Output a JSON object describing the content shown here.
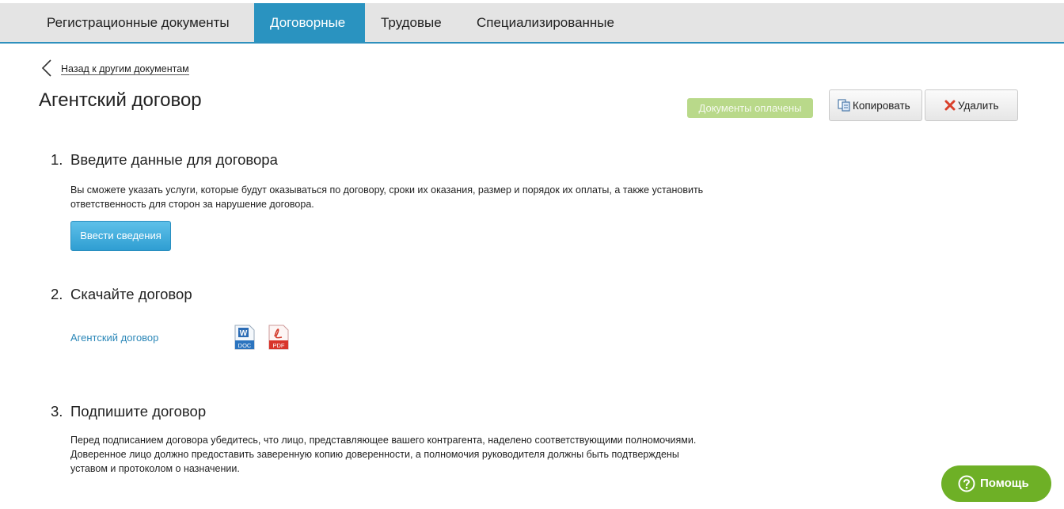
{
  "tabs": [
    {
      "label": "Регистрационные документы",
      "active": false
    },
    {
      "label": "Договорные",
      "active": true
    },
    {
      "label": "Трудовые",
      "active": false
    },
    {
      "label": "Специализированные",
      "active": false
    }
  ],
  "back_label": "Назад к другим документам",
  "page_title": "Агентский договор",
  "status_badge": "Документы оплачены",
  "copy_label": "Копировать",
  "delete_label": "Удалить",
  "steps": [
    {
      "number": "1.",
      "title": "Введите данные для договора",
      "text": "Вы сможете указать услуги, которые будут оказываться по договору, сроки их оказания, размер и порядок их оплаты, а также установить ответственность для сторон за нарушение договора.",
      "button": "Ввести сведения"
    },
    {
      "number": "2.",
      "title": "Скачайте договор",
      "doc_link": "Агентский договор",
      "doc_icon_label": "DOC",
      "pdf_icon_label": "PDF"
    },
    {
      "number": "3.",
      "title": "Подпишите договор",
      "text": "Перед подписанием договора убедитесь, что лицо, представляющее вашего контрагента, наделено соответствующими полномочиями. Доверенное лицо должно предоставить заверенную копию доверенности, а полномочия руководителя должны быть подтверждены уставом и протоколом о назначении."
    }
  ],
  "help_label": "Помощь",
  "colors": {
    "accent": "#2a93c0",
    "paid_badge": "#b9d98a",
    "help": "#6eb026",
    "link": "#2b87b8"
  },
  "icons": [
    "chevron-left-icon",
    "copy-icon",
    "delete-x-icon",
    "word-doc-icon",
    "pdf-icon",
    "help-question-icon"
  ]
}
